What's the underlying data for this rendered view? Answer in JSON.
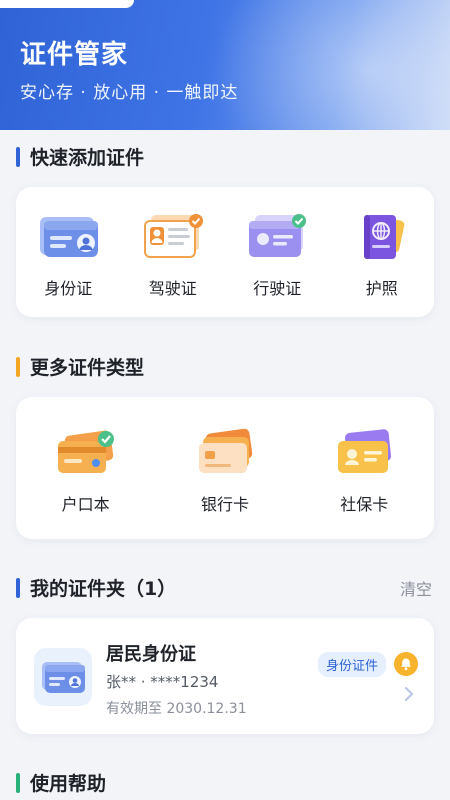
{
  "header": {
    "title": "证件管家",
    "subtitle": "安心存 · 放心用 · 一触即达"
  },
  "quick_add": {
    "title": "快速添加证件",
    "accent": "#2f63d6",
    "items": [
      {
        "label": "身份证",
        "icon": "id-card-icon"
      },
      {
        "label": "驾驶证",
        "icon": "driver-license-icon"
      },
      {
        "label": "行驶证",
        "icon": "vehicle-license-icon"
      },
      {
        "label": "护照",
        "icon": "passport-icon"
      }
    ]
  },
  "more_types": {
    "title": "更多证件类型",
    "accent": "#f5a623",
    "items": [
      {
        "label": "户口本",
        "icon": "household-register-icon"
      },
      {
        "label": "银行卡",
        "icon": "bank-card-icon"
      },
      {
        "label": "社保卡",
        "icon": "social-security-card-icon"
      }
    ]
  },
  "wallet": {
    "title": "我的证件夹（1）",
    "accent": "#2f63d6",
    "clear_label": "清空",
    "documents": [
      {
        "name": "居民身份证",
        "number": "张** · ****1234",
        "expiry": "有效期至 2030.12.31",
        "badge": "身份证件",
        "icon": "id-card-icon"
      }
    ]
  },
  "help": {
    "title": "使用帮助",
    "accent": "#27b07a"
  }
}
